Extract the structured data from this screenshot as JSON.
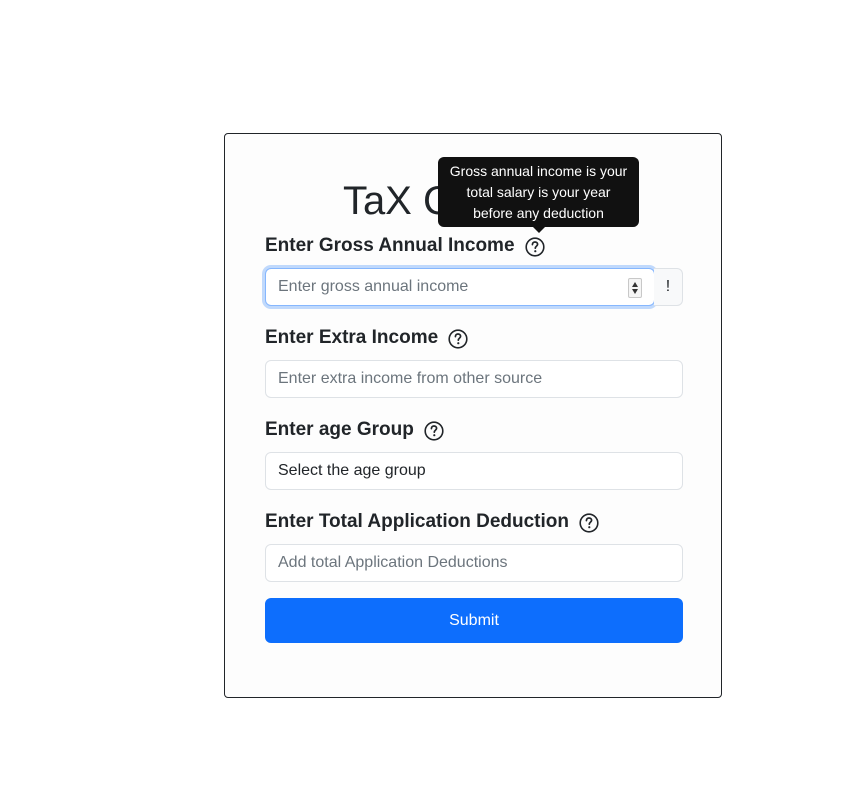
{
  "form": {
    "title": "TaX Calculator",
    "gross_income": {
      "label": "Enter Gross Annual Income",
      "placeholder": "Enter gross annual income",
      "addon": "!"
    },
    "extra_income": {
      "label": "Enter Extra Income",
      "placeholder": "Enter extra income from other source"
    },
    "age_group": {
      "label": "Enter age Group",
      "selected": "Select the age group"
    },
    "deductions": {
      "label": "Enter Total Application Deduction",
      "placeholder": "Add total Application Deductions"
    },
    "submit_label": "Submit"
  },
  "tooltip": {
    "text": "Gross annual income is your total salary is your year before any deduction"
  },
  "icons": {
    "help": "question-circle-icon",
    "spinner": "number-spinner-icon"
  },
  "colors": {
    "primary": "#0d6efd",
    "tooltip_bg": "#111111",
    "focus_border": "#86b7fe"
  }
}
